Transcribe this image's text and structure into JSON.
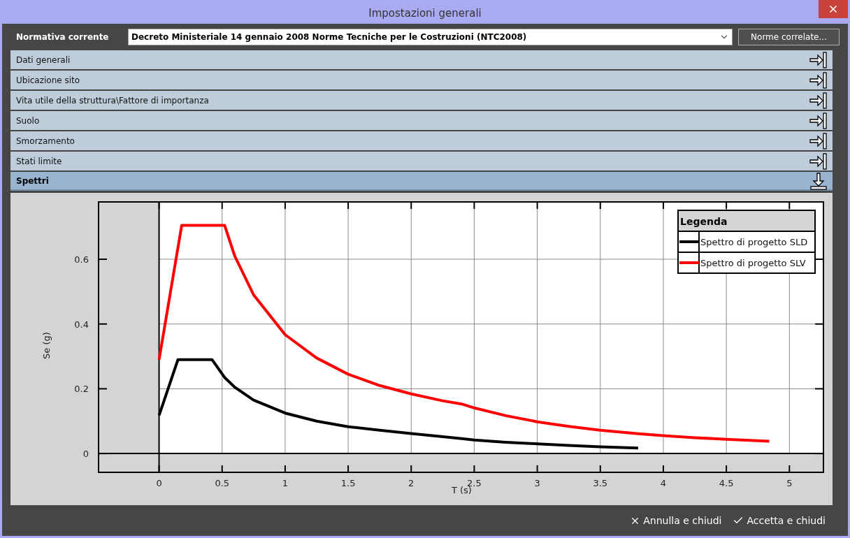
{
  "window": {
    "title": "Impostazioni generali"
  },
  "standard": {
    "label": "Normativa corrente",
    "value": "Decreto Ministeriale 14 gennaio 2008 Norme Tecniche per le Costruzioni (NTC2008)",
    "button": "Norme correlate..."
  },
  "sections": [
    {
      "label": "Dati generali",
      "expanded": false
    },
    {
      "label": "Ubicazione sito",
      "expanded": false
    },
    {
      "label": "Vita utile della struttura\\Fattore di importanza",
      "expanded": false
    },
    {
      "label": "Suolo",
      "expanded": false
    },
    {
      "label": "Smorzamento",
      "expanded": false
    },
    {
      "label": "Stati limite",
      "expanded": false
    },
    {
      "label": "Spettri",
      "expanded": true
    }
  ],
  "spectra": {
    "legend_title": "Legenda",
    "chart_data": {
      "type": "line",
      "xlabel": "T (s)",
      "ylabel": "Se (g)",
      "x": [
        0,
        0.15,
        0.18,
        0.42,
        0.52,
        0.6,
        0.75,
        1,
        1.25,
        1.5,
        1.75,
        2,
        2.25,
        2.4,
        2.5,
        2.75,
        3,
        3.25,
        3.5,
        3.8,
        4,
        4.25,
        4.5,
        4.84
      ],
      "series": [
        {
          "name": "Spettro di progetto SLD",
          "color": "#000000",
          "values": [
            0.118,
            0.29,
            0.29,
            0.29,
            0.235,
            0.205,
            0.165,
            0.125,
            0.1,
            0.083,
            0.072,
            0.062,
            0.052,
            0.046,
            0.042,
            0.035,
            0.03,
            0.025,
            0.021,
            0.017,
            null,
            null,
            null,
            null
          ]
        },
        {
          "name": "Spettro di progetto SLV",
          "color": "#ff0000",
          "values": [
            0.29,
            0.636,
            0.705,
            0.705,
            0.705,
            0.61,
            0.49,
            0.367,
            0.295,
            0.245,
            0.21,
            0.184,
            0.163,
            0.153,
            0.141,
            0.117,
            0.098,
            0.084,
            0.072,
            0.061,
            0.055,
            0.049,
            0.044,
            0.038
          ]
        }
      ],
      "xlim": [
        -0.48,
        5.27
      ],
      "ylim": [
        -0.058,
        0.777
      ],
      "xticks": [
        0,
        0.5,
        1,
        1.5,
        2,
        2.5,
        3,
        3.5,
        4,
        4.5,
        5
      ],
      "yticks": [
        0,
        0.2,
        0.4,
        0.6
      ],
      "grid": true,
      "legend": true
    }
  },
  "footer": {
    "buttons": [
      {
        "label": "Annulla e chiudi",
        "kind": "cancel"
      },
      {
        "label": "Accetta e chiudi",
        "kind": "accept"
      }
    ]
  }
}
